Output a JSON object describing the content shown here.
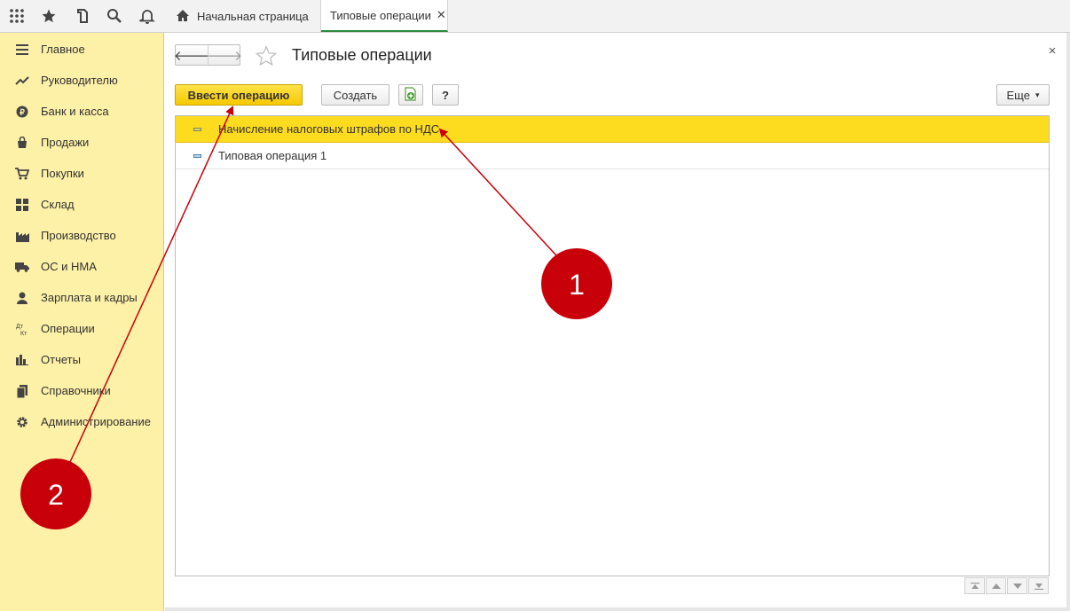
{
  "topbar": {
    "icons": [
      "apps-grid-icon",
      "star-icon",
      "history-icon",
      "search-icon",
      "bell-icon"
    ],
    "tabs": [
      {
        "label": "Начальная страница",
        "icon": "home-icon"
      },
      {
        "label": "Типовые операции",
        "close": "✕"
      }
    ]
  },
  "sidebar": {
    "items": [
      {
        "label": "Главное",
        "icon": "menu-icon"
      },
      {
        "label": "Руководителю",
        "icon": "trend-icon"
      },
      {
        "label": "Банк и касса",
        "icon": "coin-icon"
      },
      {
        "label": "Продажи",
        "icon": "bag-icon"
      },
      {
        "label": "Покупки",
        "icon": "cart-icon"
      },
      {
        "label": "Склад",
        "icon": "warehouse-icon"
      },
      {
        "label": "Производство",
        "icon": "factory-icon"
      },
      {
        "label": "ОС и НМА",
        "icon": "truck-icon"
      },
      {
        "label": "Зарплата и кадры",
        "icon": "person-icon"
      },
      {
        "label": "Операции",
        "icon": "dt-kt-icon"
      },
      {
        "label": "Отчеты",
        "icon": "bar-chart-icon"
      },
      {
        "label": "Справочники",
        "icon": "books-icon"
      },
      {
        "label": "Администрирование",
        "icon": "gear-icon"
      }
    ],
    "dt_kt_glyph_top": "Дт",
    "dt_kt_glyph_bottom": "Кт"
  },
  "header": {
    "title": "Типовые операции",
    "back_glyph": "🡐",
    "forward_glyph": "🡒",
    "close_glyph": "×"
  },
  "toolbar": {
    "enter_operation_label": "Ввести операцию",
    "create_label": "Создать",
    "help_label": "?",
    "more_label": "Еще"
  },
  "list": {
    "rows": [
      {
        "label": "Начисление налоговых штрафов по НДС",
        "selected": true
      },
      {
        "label": "Типовая операция 1",
        "selected": false
      }
    ]
  },
  "annotations": {
    "badge1": "1",
    "badge2": "2",
    "color": "#c8000a"
  },
  "colors": {
    "sidebar_bg": "#fdf0a7",
    "primary_button": "#f5c800",
    "selection": "#fddb1f",
    "active_tab_underline": "#2b8a3e"
  }
}
